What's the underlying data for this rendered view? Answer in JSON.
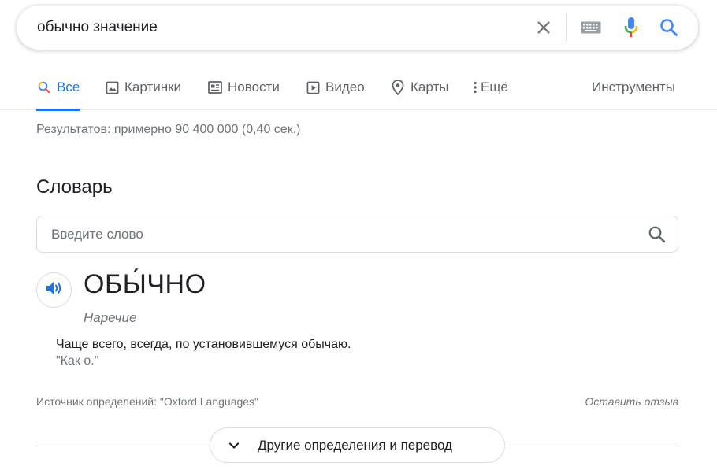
{
  "search": {
    "query": "обычно значение"
  },
  "icons": {
    "clear": "close-icon",
    "keyboard": "keyboard-icon",
    "mic": "microphone-icon",
    "search": "search-icon"
  },
  "colors": {
    "accent": "#1a73e8",
    "mic_blue": "#4285f4",
    "mic_red": "#ea4335",
    "mic_yellow": "#fbbc04",
    "mic_green": "#34a853",
    "text_secondary": "#70757a"
  },
  "tabs": [
    {
      "label": "Все",
      "active": true
    },
    {
      "label": "Картинки"
    },
    {
      "label": "Новости"
    },
    {
      "label": "Видео"
    },
    {
      "label": "Карты"
    },
    {
      "label": "Ещё"
    },
    {
      "label": "Инструменты"
    }
  ],
  "results": {
    "stats": "Результатов: примерно 90 400 000 (0,40 сек.)"
  },
  "dictionary": {
    "heading": "Словарь",
    "input_placeholder": "Введите слово",
    "headword": "ОБЫ́ЧНО",
    "part_of_speech": "Наречие",
    "definition": "Чаще всего, всегда, по установившемуся обычаю.",
    "example": "\"Как о.\"",
    "source": "Источник определений: \"Oxford Languages\"",
    "feedback": "Оставить отзыв",
    "more_button": "Другие определения и перевод"
  }
}
